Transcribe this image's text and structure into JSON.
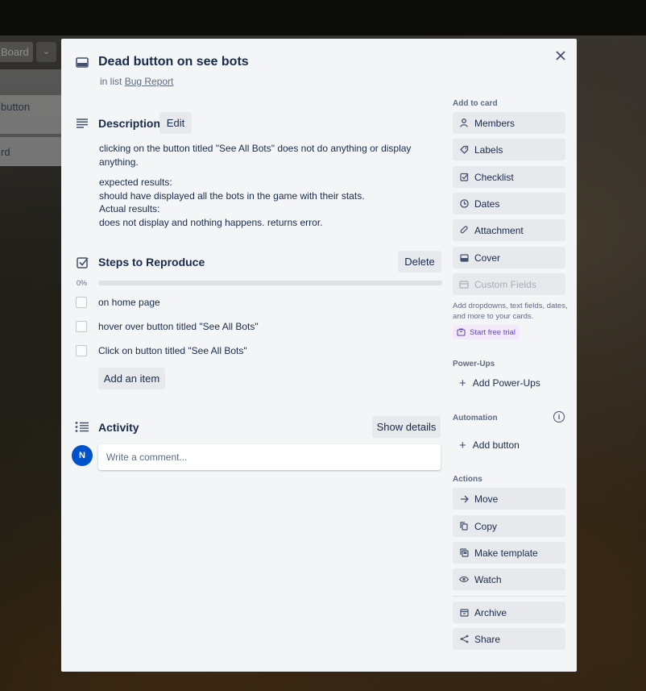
{
  "background": {
    "board_button_label": "Board",
    "list_cards": [
      "button",
      "rd"
    ]
  },
  "card": {
    "title": "Dead button on see bots",
    "in_list_prefix": "in list",
    "list_name": "Bug Report"
  },
  "description": {
    "heading": "Description",
    "edit_label": "Edit",
    "paragraphs": [
      "clicking on the button titled \"See All Bots\" does not do anything or display anything.",
      "expected results:",
      "should have displayed all the bots in the game with their stats.",
      "Actual results:",
      "does not display and nothing happens. returns error."
    ]
  },
  "checklist": {
    "heading": "Steps to Reproduce",
    "delete_label": "Delete",
    "progress_label": "0%",
    "progress_fraction": 0,
    "items": [
      {
        "text": "on home page",
        "checked": false
      },
      {
        "text": "hover over button titled \"See All Bots\"",
        "checked": false
      },
      {
        "text": "Click on button titled \"See All Bots\"",
        "checked": false
      }
    ],
    "add_item_label": "Add an item"
  },
  "activity": {
    "heading": "Activity",
    "show_details_label": "Show details",
    "avatar_initial": "N",
    "comment_placeholder": "Write a comment..."
  },
  "sidebar": {
    "add_to_card_heading": "Add to card",
    "add_to_card": [
      {
        "label": "Members",
        "icon": "person-icon"
      },
      {
        "label": "Labels",
        "icon": "tag-icon"
      },
      {
        "label": "Checklist",
        "icon": "checkbox-icon"
      },
      {
        "label": "Dates",
        "icon": "clock-icon"
      },
      {
        "label": "Attachment",
        "icon": "paperclip-icon"
      },
      {
        "label": "Cover",
        "icon": "cover-icon"
      },
      {
        "label": "Custom Fields",
        "icon": "custom-fields-icon"
      }
    ],
    "custom_fields_note": "Add dropdowns, text fields, dates, and more to your cards.",
    "free_trial_label": "Start free trial",
    "power_ups_heading": "Power-Ups",
    "add_power_ups_label": "Add Power-Ups",
    "automation_heading": "Automation",
    "add_button_label": "Add button",
    "actions_heading": "Actions",
    "actions": [
      {
        "label": "Move",
        "icon": "arrow-right-icon"
      },
      {
        "label": "Copy",
        "icon": "copy-icon"
      },
      {
        "label": "Make template",
        "icon": "template-icon"
      },
      {
        "label": "Watch",
        "icon": "eye-icon"
      },
      {
        "label": "Archive",
        "icon": "archive-icon"
      },
      {
        "label": "Share",
        "icon": "share-icon"
      }
    ]
  },
  "colors": {
    "modal_bg": "#f4f5f7",
    "button_bg": "#e8e9ec",
    "avatar": "#0052cc",
    "trial_bg": "#f3e8fc"
  }
}
